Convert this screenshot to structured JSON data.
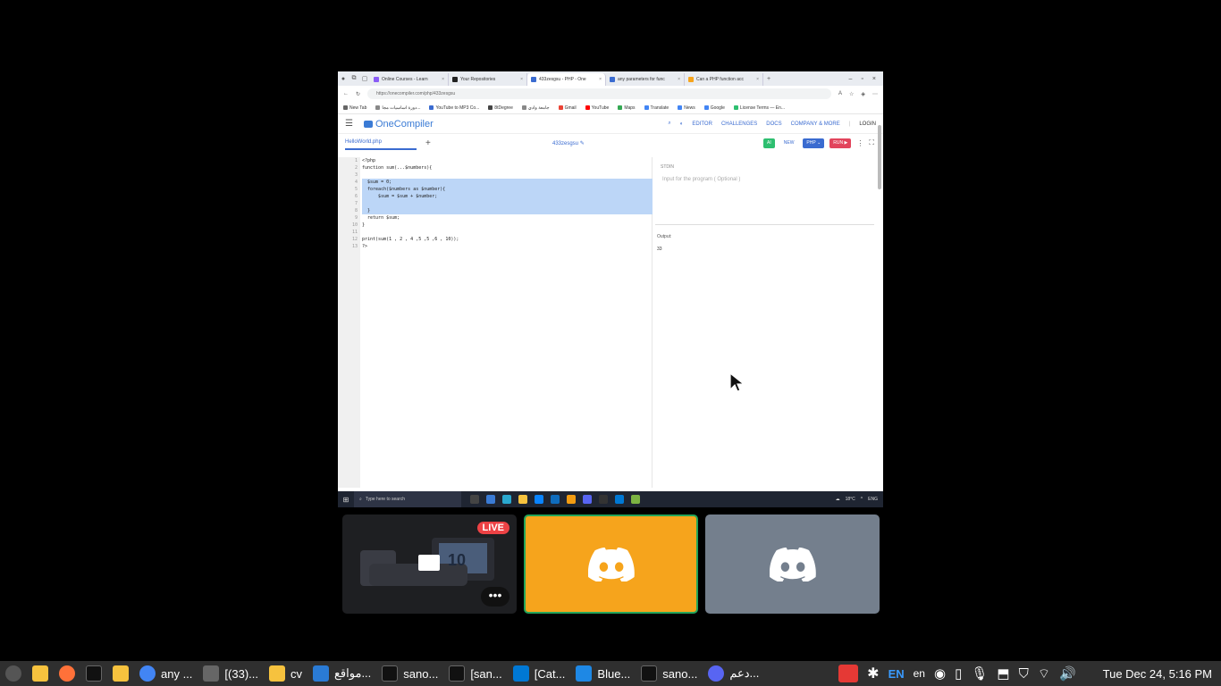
{
  "browser": {
    "tabs": [
      {
        "title": "Online Courses - Learn",
        "color": "#8a5cf6"
      },
      {
        "title": "Your Repositories",
        "color": "#222222"
      },
      {
        "title": "433zesgsu - PHP - One",
        "color": "#3a6bd0",
        "active": true
      },
      {
        "title": "any parameters for func",
        "color": "#3a6bd0"
      },
      {
        "title": "Can a PHP function acc",
        "color": "#f6a41c"
      }
    ],
    "url": "https://onecompiler.com/php/433zesgsu",
    "bookmarks": [
      {
        "label": "New Tab",
        "color": "#666666"
      },
      {
        "label": "دورة اساسيات مجا...",
        "color": "#888888"
      },
      {
        "label": "YouTube to MP3 Co...",
        "color": "#3a6bd0"
      },
      {
        "label": "8tDegree",
        "color": "#444444"
      },
      {
        "label": "جامعة وادي",
        "color": "#888888"
      },
      {
        "label": "Gmail",
        "color": "#ea4335"
      },
      {
        "label": "YouTube",
        "color": "#ff0000"
      },
      {
        "label": "Maps",
        "color": "#34a853"
      },
      {
        "label": "Translate",
        "color": "#4285f4"
      },
      {
        "label": "News",
        "color": "#4285f4"
      },
      {
        "label": "Google",
        "color": "#4285f4"
      },
      {
        "label": "License Terms — En...",
        "color": "#2ebf70"
      }
    ]
  },
  "onecompiler": {
    "logo": "OneCompiler",
    "nav": [
      "EDITOR",
      "CHALLENGES",
      "DOCS",
      "COMPANY & MORE",
      "LOGIN"
    ],
    "file_name": "HelloWorld.php",
    "code_id": "433zesgsu",
    "buttons": {
      "ai": "AI",
      "new": "NEW",
      "lang": "PHP",
      "run": "RUN"
    },
    "code_lines": [
      "<?php",
      "function sum(...$numbers){",
      "",
      "  $sum = 0;",
      "  foreach($numbers as $number){",
      "      $sum = $sum + $number;",
      "",
      "  }",
      "  return $sum;",
      "}",
      "",
      "print(sum(1 , 2 , 4 ,5 ,5 ,6 , 10));",
      "?>"
    ],
    "stdin_label": "STDIN",
    "stdin_placeholder": "Input for the program ( Optional )",
    "output_label": "Output:",
    "output_value": "33"
  },
  "windows_taskbar": {
    "search_placeholder": "Type here to search",
    "temperature": "18°C",
    "lang": "ENG"
  },
  "participants": {
    "live_badge": "LIVE",
    "stream_counter": "10",
    "more_label": "•••",
    "tile_colors": [
      "#1e1f22",
      "#f6a41c",
      "#747f8d"
    ]
  },
  "taskbar": {
    "items": [
      {
        "label": "",
        "icon": "mint-menu-icon"
      },
      {
        "label": "",
        "icon": "files-icon"
      },
      {
        "label": "",
        "icon": "firefox-icon"
      },
      {
        "label": "",
        "icon": "terminal-icon"
      },
      {
        "label": "",
        "icon": "folder-icon"
      },
      {
        "label": "any ...",
        "icon": "chrome-icon"
      },
      {
        "label": "[(33)...",
        "icon": "window-icon"
      },
      {
        "label": "cv",
        "icon": "folder-icon"
      },
      {
        "label": "مواقع...",
        "icon": "app-icon"
      },
      {
        "label": "sano...",
        "icon": "terminal-icon"
      },
      {
        "label": "[san...",
        "icon": "terminal-icon"
      },
      {
        "label": "[Cat...",
        "icon": "vscode-icon"
      },
      {
        "label": "Blue...",
        "icon": "bluetooth-icon"
      },
      {
        "label": "sano...",
        "icon": "terminal-icon"
      },
      {
        "label": "دعم...",
        "icon": "discord-icon"
      }
    ],
    "keyboard_layout": "EN",
    "keyboard_lang": "en",
    "clock": "Tue Dec 24,  5:16 PM"
  }
}
